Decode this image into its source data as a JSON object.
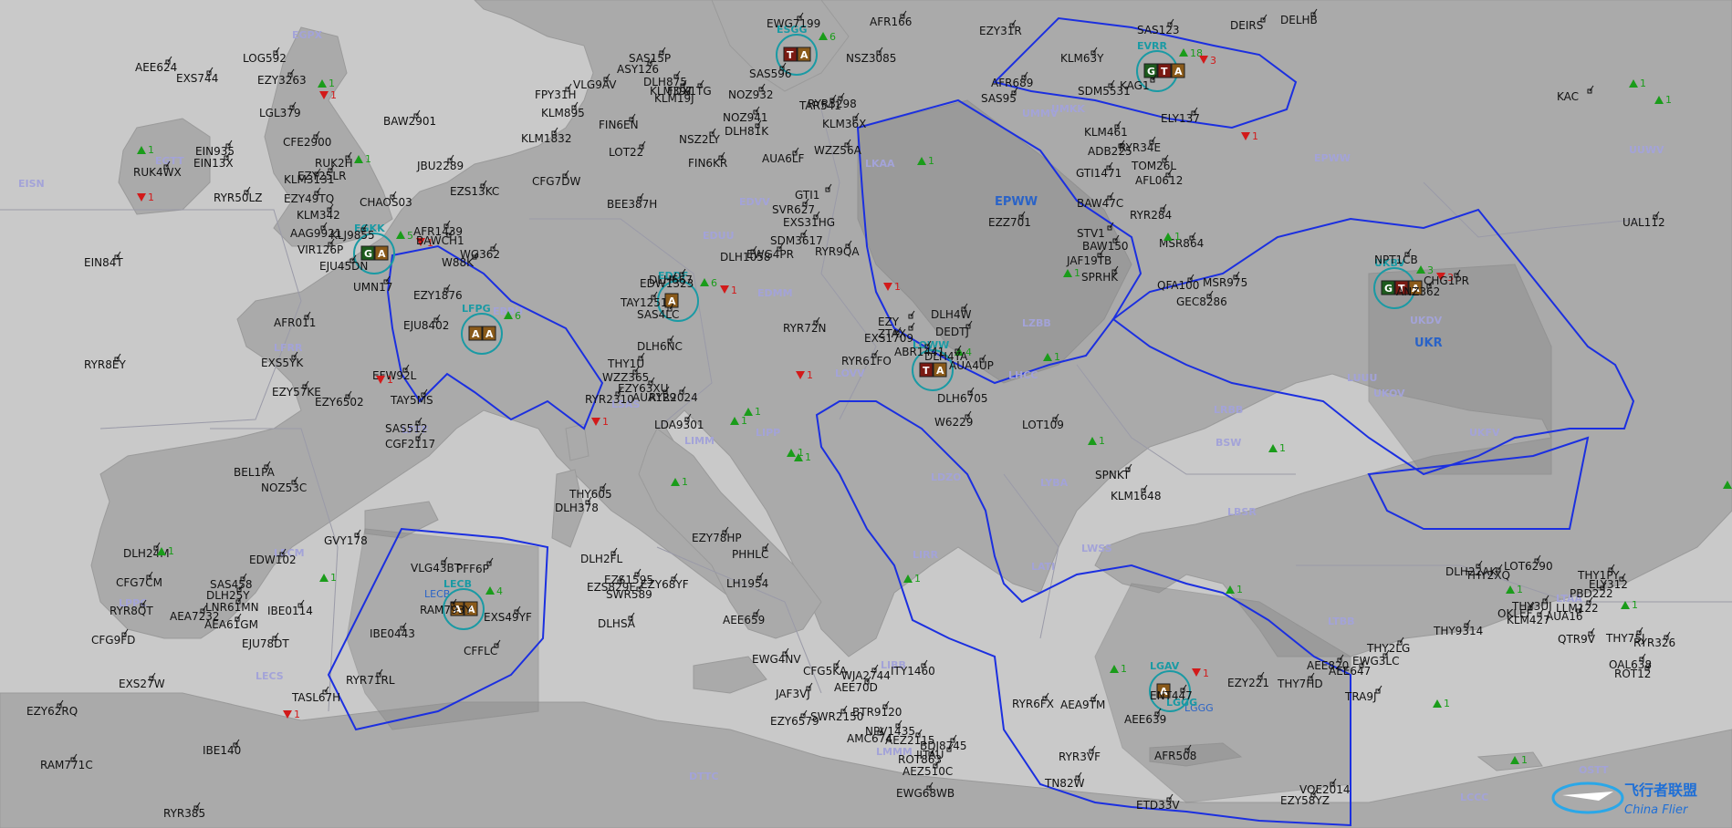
{
  "map": {
    "colors": {
      "sea": "#c9c9c9",
      "land": "#a8a8a8",
      "region_shade": "#8e8e8e",
      "border_blue": "#1b2fe0",
      "airport_cyan": "#1a9aa4",
      "arrow_up": "#1a9c1a",
      "arrow_down": "#d21a1a",
      "text": "#111111"
    },
    "fir_labels": [
      "EISN",
      "EGPX",
      "EGTT",
      "LFRR",
      "LFFF",
      "LECM",
      "LECB",
      "LPPC",
      "LECS",
      "EBBU",
      "EDVV",
      "EDUU",
      "EDMM",
      "LSAS",
      "LIMM",
      "LIPP",
      "LIRR",
      "LIBB",
      "LDZO",
      "LYBA",
      "LWSS",
      "LATI",
      "LGGG",
      "LHCC",
      "LOVV",
      "LZBB",
      "LKAA",
      "EPWW",
      "UMMV",
      "UKBV",
      "UKDV",
      "UUWV",
      "LRBB",
      "LBSR",
      "LUUU",
      "UKOV",
      "UKFV",
      "LTBB",
      "LTAA",
      "OSTT",
      "LCCC",
      "HLLL",
      "DTTC",
      "LMMM",
      "UMKK",
      "ESAA",
      "EYVL",
      "EVRR",
      "EETT",
      "EFIN"
    ],
    "airports": [
      {
        "code": "EGKK",
        "arrows": [
          {
            "dir": "up",
            "n": "5"
          },
          {
            "dir": "down",
            "n": "1"
          }
        ],
        "badges": [
          "G",
          "A"
        ]
      },
      {
        "code": "LFPG",
        "arrows": [
          {
            "dir": "up",
            "n": "6"
          }
        ],
        "badges": [
          "A",
          "A"
        ]
      },
      {
        "code": "EDDF",
        "arrows": [
          {
            "dir": "up",
            "n": "6"
          },
          {
            "dir": "down",
            "n": "1"
          }
        ],
        "badges": [
          "A"
        ]
      },
      {
        "code": "ESGG",
        "arrows": [
          {
            "dir": "up",
            "n": "6"
          }
        ],
        "badges": [
          "T",
          "A"
        ]
      },
      {
        "code": "EVRR",
        "arrows": [
          {
            "dir": "up",
            "n": "18"
          },
          {
            "dir": "down",
            "n": "3"
          }
        ],
        "badges": [
          "G",
          "T",
          "A"
        ]
      },
      {
        "code": "UKBV",
        "arrows": [
          {
            "dir": "up",
            "n": "3"
          },
          {
            "dir": "down",
            "n": "3"
          }
        ],
        "badges": [
          "G",
          "T",
          "A"
        ]
      },
      {
        "code": "LECB",
        "arrows": [
          {
            "dir": "up",
            "n": "4"
          }
        ],
        "badges": [
          "A",
          "A"
        ]
      },
      {
        "code": "LGAV",
        "arrows": [
          {
            "dir": "down",
            "n": "1"
          }
        ],
        "badges": [
          "A"
        ]
      },
      {
        "code": "LOWW",
        "arrows": [
          {
            "dir": "up",
            "n": "4"
          }
        ],
        "badges": [
          "T",
          "A"
        ]
      },
      {
        "code": "LGGG",
        "arrows": [],
        "badges": []
      }
    ],
    "region_labels": [
      "EPWW",
      "UKR",
      "LECB",
      "LGGG",
      "BSW"
    ],
    "flights": [
      "AEE624",
      "LOG592",
      "EXS744",
      "EZY3263",
      "LGL379",
      "BAW2901",
      "CFE2900",
      "EIN935",
      "RUK4WX",
      "RUK2H",
      "EIN13X",
      "EZY25LR",
      "KLM3131",
      "RYR50LZ",
      "EZY49TQ",
      "JBU2289",
      "CHAOS03",
      "KLM342",
      "AAG9921",
      "EJU45DN",
      "EIN84T",
      "KLJ9855",
      "VIR126P",
      "AFR1439",
      "BAWCH1",
      "WG362",
      "W88K",
      "UMN17",
      "EZY1876",
      "EJU8402",
      "AFR011",
      "RYR8EY",
      "EXS5YK",
      "EZY57KE",
      "EFW92L",
      "TAY5MS",
      "SAS512",
      "EZY6502",
      "CGF2117",
      "BEL1PA",
      "NOZ53C",
      "GVY178",
      "EDW102",
      "DLH24M",
      "CFG7CM",
      "SAS458",
      "DLH25Y",
      "LNR61MN",
      "RYR8QT",
      "AEA7232",
      "AEA61GM",
      "IBE0114",
      "CFG9FD",
      "EJU78DT",
      "EXS27W",
      "TASL67H",
      "EZY62RQ",
      "RAM771C",
      "IBE140",
      "RYR385",
      "RYR71RL",
      "IBE0443",
      "CFFLC",
      "RAM793Y",
      "EXS49YF",
      "VLG43BT",
      "PFF6P",
      "EZS13KC",
      "CFG7DW",
      "BEE387H",
      "VLG9AV",
      "FPY31H",
      "KLM895",
      "KLM1832",
      "FIN6EN",
      "LOT22",
      "SAS15P",
      "ASY126",
      "DLH875",
      "KLM39T",
      "KLM19J",
      "FDX1TG",
      "EWG7199",
      "AFR166",
      "NSZ3085",
      "SAS596",
      "NOZ932",
      "TAR541",
      "RYR3298",
      "KLM36X",
      "NOZ941",
      "DLH81K",
      "NSZ2LY",
      "FIN6KR",
      "AUA6LF",
      "WZZ56A",
      "EZY31R",
      "KLM63Y",
      "DELHB",
      "DEIRS",
      "SAS123",
      "SAS95",
      "AFR689",
      "SDM5531",
      "KAG1",
      "ELY137",
      "KLM461",
      "ADB225",
      "RYR34E",
      "GTI1471",
      "TOM26L",
      "AFL0612",
      "BAW47C",
      "RYR284",
      "EZZ701",
      "STV1",
      "BAW150",
      "JAF19TB",
      "SPRHK",
      "MSR864",
      "GEC8286",
      "QFA100",
      "MSR975",
      "NPT1CB",
      "ANZ362",
      "CHG1PR",
      "KAC",
      "UAL112",
      "GTI1",
      "EXS31HG",
      "SVR627",
      "SDM3617",
      "RYR9QA",
      "EWG4PR",
      "DLH1058",
      "DLH667",
      "EDW1323",
      "TAY1251",
      "SAS4LC",
      "DLH6NC",
      "DLH4W",
      "DEDTJ",
      "RYR72N",
      "ZTAX",
      "ABR1441",
      "RYR61FO",
      "EXS1709",
      "EZY",
      "DLH4YA",
      "AUA4UP",
      "W6229",
      "DLH6705",
      "LOT109",
      "SPNKT",
      "KLM1648",
      "THY1U",
      "WZZ365",
      "EZY63XU",
      "AUA129",
      "RYR2310",
      "RYR2024",
      "LDA9301",
      "THY605",
      "DLH378",
      "DLH2FL",
      "EZS829E",
      "DLHSA",
      "EZS1595",
      "SWR589",
      "EZY68YF",
      "EZY78HP",
      "PHHLC",
      "LH1954",
      "AEE659",
      "EWG4NV",
      "JAF3VJ",
      "EZY6579",
      "SWR2150",
      "CFG5KA",
      "ITY1460",
      "WJA2744",
      "AEE70D",
      "NPV1435",
      "AEZ2115",
      "ROT863",
      "BTR9120",
      "IITAU",
      "AMC674",
      "BDJ8745",
      "AEZ510C",
      "EWG68WB",
      "TN82W",
      "RYR6FX",
      "AEA9TM",
      "RYR3VF",
      "AEE639",
      "AFR508",
      "ETD33V",
      "ENT447",
      "EZY221",
      "THY7HD",
      "VOE2014",
      "EZY58YZ",
      "AEE647",
      "TRA9J",
      "AEE820",
      "EWG3LC",
      "THY2LG",
      "THY9314",
      "DLH22AK",
      "LOT6290",
      "THY2XQ",
      "OKLEF",
      "KLM427",
      "THY3UJ",
      "AUA16",
      "LLM122",
      "PBD222",
      "ELY312",
      "THY1PY",
      "THY75J",
      "RYR326",
      "QTR9V",
      "OAL638",
      "ROT12"
    ],
    "watermark": {
      "line1": "飞行者联盟",
      "line2": "China Flier"
    }
  }
}
